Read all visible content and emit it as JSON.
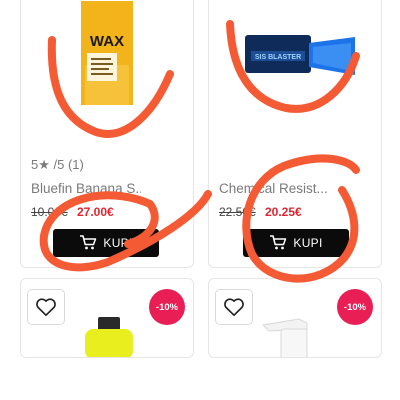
{
  "products": [
    {
      "rating_label": "5★ /5 (1)",
      "name": "Bluefin Banana S...",
      "old_price": "10.00€",
      "new_price": "27.00€",
      "buy_label": "KUPI",
      "package_text": "WAX"
    },
    {
      "name": "Chemical Resist...",
      "old_price": "22.50€",
      "new_price": "20.25€",
      "buy_label": "KUPI",
      "package_text": "SIS BLASTER"
    },
    {
      "discount_badge": "-10%"
    },
    {
      "discount_badge": "-10%"
    }
  ],
  "colors": {
    "price_red": "#e0242f",
    "badge_pink": "#e91e55",
    "annotation_orange": "#f45a33",
    "button_black": "#0b0b0b"
  },
  "icons": [
    "cart-icon",
    "heart-icon"
  ]
}
